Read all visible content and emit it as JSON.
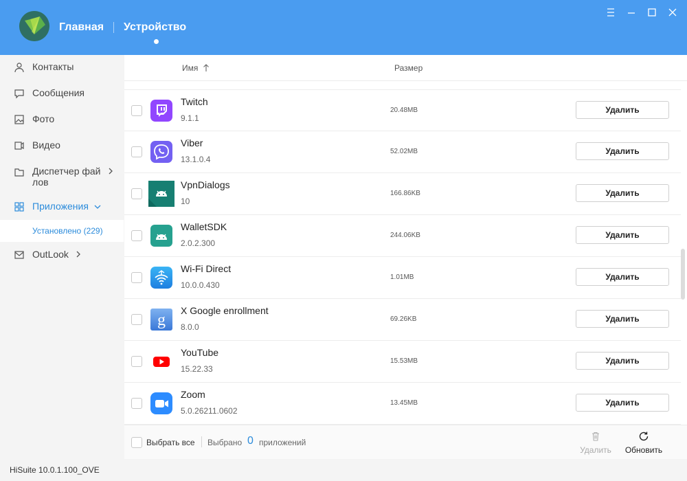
{
  "header": {
    "home_label": "Главная",
    "device_label": "Устройство"
  },
  "sidebar": {
    "items": [
      {
        "label": "Контакты",
        "icon": "person-icon"
      },
      {
        "label": "Сообщения",
        "icon": "chat-bubble-icon"
      },
      {
        "label": "Фото",
        "icon": "photo-icon"
      },
      {
        "label": "Видео",
        "icon": "video-camera-icon"
      },
      {
        "label": "Диспетчер фай лов",
        "icon": "folder-icon"
      },
      {
        "label": "Приложения",
        "icon": "apps-grid-icon"
      },
      {
        "label": "OutLook",
        "icon": "mail-icon"
      }
    ],
    "sub_item": "Установлено (229)"
  },
  "columns": {
    "name": "Имя",
    "size": "Размер"
  },
  "apps": [
    {
      "name": "Twitch",
      "version": "9.1.1",
      "size": "20.48MB",
      "icon": "twitch-app-icon"
    },
    {
      "name": "Viber",
      "version": "13.1.0.4",
      "size": "52.02MB",
      "icon": "viber-app-icon"
    },
    {
      "name": "VpnDialogs",
      "version": "10",
      "size": "166.86KB",
      "icon": "android-app-icon"
    },
    {
      "name": "WalletSDK",
      "version": "2.0.2.300",
      "size": "244.06KB",
      "icon": "android-app-icon"
    },
    {
      "name": "Wi-Fi Direct",
      "version": "10.0.0.430",
      "size": "1.01MB",
      "icon": "wifi-direct-app-icon"
    },
    {
      "name": "X Google enrollment",
      "version": "8.0.0",
      "size": "69.26KB",
      "icon": "google-app-icon"
    },
    {
      "name": "YouTube",
      "version": "15.22.33",
      "size": "15.53MB",
      "icon": "youtube-app-icon"
    },
    {
      "name": "Zoom",
      "version": "5.0.26211.0602",
      "size": "13.45MB",
      "icon": "zoom-app-icon"
    }
  ],
  "delete_label": "Удалить",
  "footer": {
    "select_all": "Выбрать все",
    "selected_prefix": "Выбрано",
    "selected_count": "0",
    "selected_suffix": "приложений",
    "delete_label": "Удалить",
    "refresh_label": "Обновить"
  },
  "version": "HiSuite 10.0.1.100_OVE",
  "colors": {
    "header_bg": "#4a9cf0",
    "accent": "#2b8bdb"
  }
}
